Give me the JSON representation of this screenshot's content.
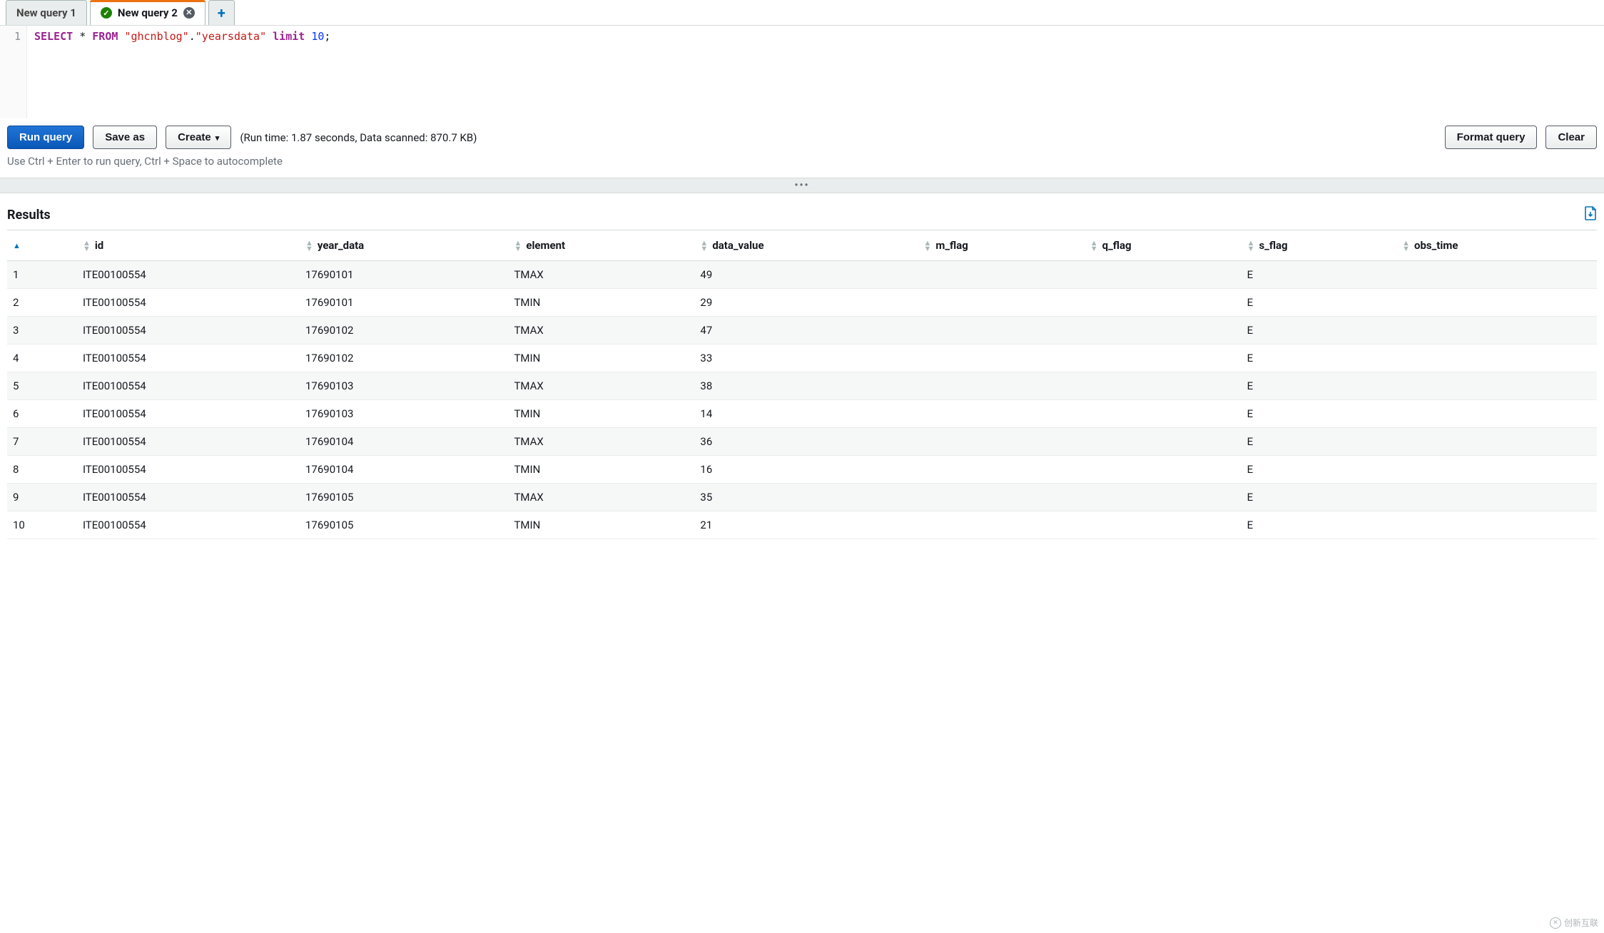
{
  "tabs": [
    {
      "label": "New query 1",
      "active": false,
      "status": null
    },
    {
      "label": "New query 2",
      "active": true,
      "status": "ok"
    }
  ],
  "new_tab_glyph": "+",
  "editor": {
    "line_number": "1",
    "tokens": {
      "select": "SELECT",
      "star": "*",
      "from": "FROM",
      "db_quoted": "\"ghcnblog\"",
      "dot": ".",
      "table_quoted": "\"yearsdata\"",
      "limit": "limit",
      "limit_n": "10",
      "semi": ";"
    }
  },
  "toolbar": {
    "run": "Run query",
    "save_as": "Save as",
    "create": "Create",
    "stats": "(Run time: 1.87 seconds, Data scanned: 870.7 KB)",
    "format": "Format query",
    "clear": "Clear"
  },
  "hint": "Use Ctrl + Enter to run query, Ctrl + Space to autocomplete",
  "drag_glyph": "•••",
  "results": {
    "title": "Results",
    "columns": [
      "",
      "id",
      "year_data",
      "element",
      "data_value",
      "m_flag",
      "q_flag",
      "s_flag",
      "obs_time"
    ],
    "rows": [
      [
        "1",
        "ITE00100554",
        "17690101",
        "TMAX",
        "49",
        "",
        "",
        "E",
        ""
      ],
      [
        "2",
        "ITE00100554",
        "17690101",
        "TMIN",
        "29",
        "",
        "",
        "E",
        ""
      ],
      [
        "3",
        "ITE00100554",
        "17690102",
        "TMAX",
        "47",
        "",
        "",
        "E",
        ""
      ],
      [
        "4",
        "ITE00100554",
        "17690102",
        "TMIN",
        "33",
        "",
        "",
        "E",
        ""
      ],
      [
        "5",
        "ITE00100554",
        "17690103",
        "TMAX",
        "38",
        "",
        "",
        "E",
        ""
      ],
      [
        "6",
        "ITE00100554",
        "17690103",
        "TMIN",
        "14",
        "",
        "",
        "E",
        ""
      ],
      [
        "7",
        "ITE00100554",
        "17690104",
        "TMAX",
        "36",
        "",
        "",
        "E",
        ""
      ],
      [
        "8",
        "ITE00100554",
        "17690104",
        "TMIN",
        "16",
        "",
        "",
        "E",
        ""
      ],
      [
        "9",
        "ITE00100554",
        "17690105",
        "TMAX",
        "35",
        "",
        "",
        "E",
        ""
      ],
      [
        "10",
        "ITE00100554",
        "17690105",
        "TMIN",
        "21",
        "",
        "",
        "E",
        ""
      ]
    ]
  },
  "watermark": "创新互联"
}
